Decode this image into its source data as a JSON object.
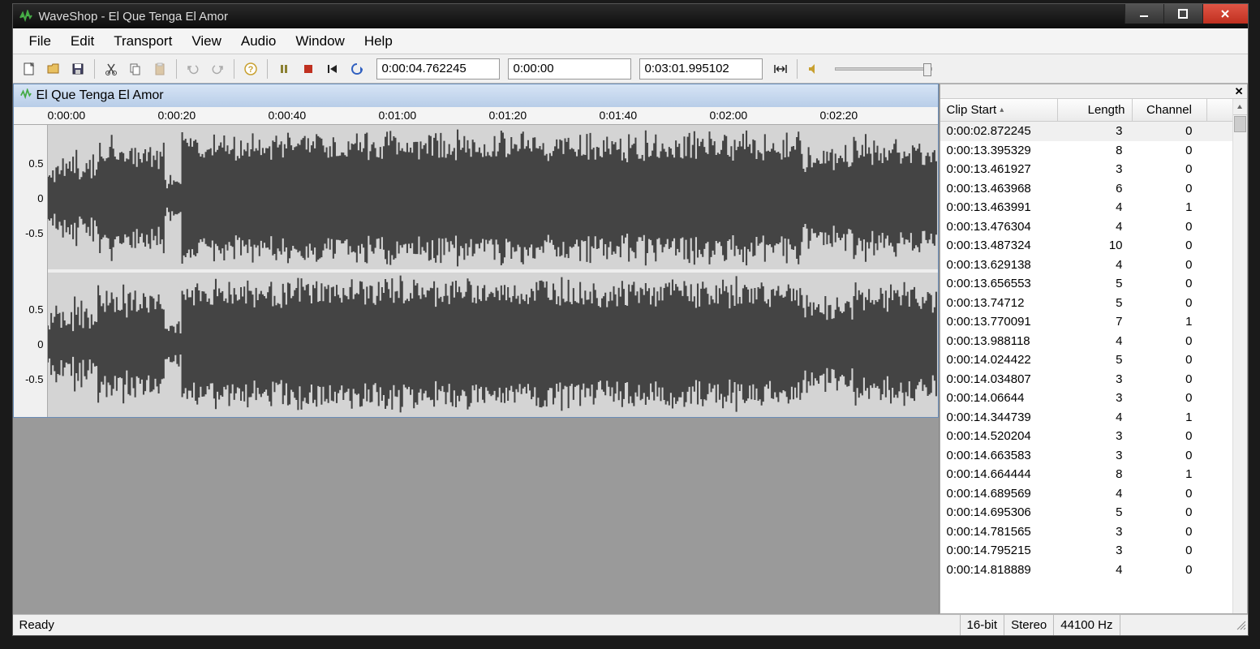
{
  "window": {
    "title": "WaveShop - El Que Tenga El Amor"
  },
  "menu": [
    "File",
    "Edit",
    "Transport",
    "View",
    "Audio",
    "Window",
    "Help"
  ],
  "toolbar": {
    "time_current": "0:00:04.762245",
    "time_sel_start": "0:00:00",
    "time_sel_end": "0:03:01.995102"
  },
  "document": {
    "title": "El Que Tenga El Amor",
    "time_ticks": [
      "0:00:00",
      "0:00:20",
      "0:00:40",
      "0:01:00",
      "0:01:20",
      "0:01:40",
      "0:02:00",
      "0:02:20"
    ],
    "amp_labels": [
      "0.5",
      "0",
      "-0.5"
    ]
  },
  "clip_table": {
    "headers": {
      "start": "Clip Start",
      "length": "Length",
      "channel": "Channel"
    },
    "rows": [
      {
        "start": "0:00:02.872245",
        "length": "3",
        "channel": "0"
      },
      {
        "start": "0:00:13.395329",
        "length": "8",
        "channel": "0"
      },
      {
        "start": "0:00:13.461927",
        "length": "3",
        "channel": "0"
      },
      {
        "start": "0:00:13.463968",
        "length": "6",
        "channel": "0"
      },
      {
        "start": "0:00:13.463991",
        "length": "4",
        "channel": "1"
      },
      {
        "start": "0:00:13.476304",
        "length": "4",
        "channel": "0"
      },
      {
        "start": "0:00:13.487324",
        "length": "10",
        "channel": "0"
      },
      {
        "start": "0:00:13.629138",
        "length": "4",
        "channel": "0"
      },
      {
        "start": "0:00:13.656553",
        "length": "5",
        "channel": "0"
      },
      {
        "start": "0:00:13.74712",
        "length": "5",
        "channel": "0"
      },
      {
        "start": "0:00:13.770091",
        "length": "7",
        "channel": "1"
      },
      {
        "start": "0:00:13.988118",
        "length": "4",
        "channel": "0"
      },
      {
        "start": "0:00:14.024422",
        "length": "5",
        "channel": "0"
      },
      {
        "start": "0:00:14.034807",
        "length": "3",
        "channel": "0"
      },
      {
        "start": "0:00:14.06644",
        "length": "3",
        "channel": "0"
      },
      {
        "start": "0:00:14.344739",
        "length": "4",
        "channel": "1"
      },
      {
        "start": "0:00:14.520204",
        "length": "3",
        "channel": "0"
      },
      {
        "start": "0:00:14.663583",
        "length": "3",
        "channel": "0"
      },
      {
        "start": "0:00:14.664444",
        "length": "8",
        "channel": "1"
      },
      {
        "start": "0:00:14.689569",
        "length": "4",
        "channel": "0"
      },
      {
        "start": "0:00:14.695306",
        "length": "5",
        "channel": "0"
      },
      {
        "start": "0:00:14.781565",
        "length": "3",
        "channel": "0"
      },
      {
        "start": "0:00:14.795215",
        "length": "3",
        "channel": "0"
      },
      {
        "start": "0:00:14.818889",
        "length": "4",
        "channel": "0"
      }
    ]
  },
  "status": {
    "ready": "Ready",
    "bits": "16-bit",
    "channels": "Stereo",
    "rate": "44100 Hz"
  }
}
